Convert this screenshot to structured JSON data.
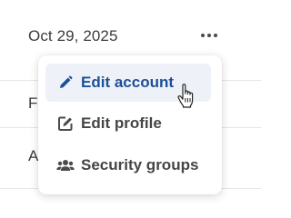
{
  "table": {
    "rows": [
      {
        "date": "Oct 29, 2025"
      },
      {
        "date": "Fe"
      },
      {
        "date": "Ap"
      }
    ],
    "actions_icon": "more-horizontal-icon"
  },
  "menu": {
    "items": [
      {
        "label": "Edit account",
        "icon": "pencil-icon",
        "active": true
      },
      {
        "label": "Edit profile",
        "icon": "edit-square-icon",
        "active": false
      },
      {
        "label": "Security groups",
        "icon": "users-icon",
        "active": false
      }
    ]
  },
  "colors": {
    "active_label": "#1f4f97",
    "active_background": "#eef2f8",
    "label": "#454545",
    "divider": "#e6e6e6"
  }
}
